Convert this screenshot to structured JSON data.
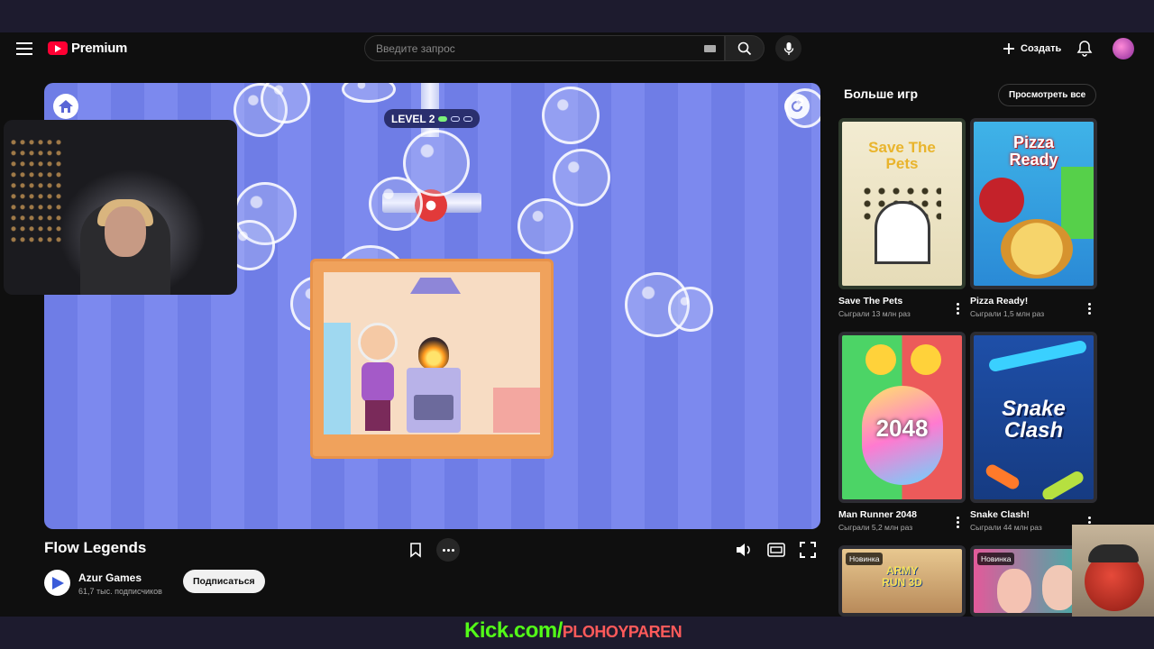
{
  "header": {
    "logo_text": "Premium",
    "search_placeholder": "Введите запрос",
    "create_label": "Создать"
  },
  "game": {
    "level_label": "LEVEL 2",
    "title": "Flow Legends",
    "channel_name": "Azur Games",
    "channel_subs": "61,7 тыс. подписчиков",
    "subscribe_label": "Подписаться"
  },
  "sidebar": {
    "heading": "Больше игр",
    "view_all": "Просмотреть все",
    "cards": [
      {
        "title": "Save The Pets",
        "plays": "Сыграли 13 млн раз",
        "thumb_text": "Save The Pets",
        "badge": ""
      },
      {
        "title": "Pizza Ready!",
        "plays": "Сыграли 1,5 млн раз",
        "thumb_text": "Pizza Ready",
        "badge": ""
      },
      {
        "title": "Man Runner 2048",
        "plays": "Сыграли 5,2 млн раз",
        "thumb_text": "2048",
        "badge": ""
      },
      {
        "title": "Snake Clash!",
        "plays": "Сыграли 44 млн раз",
        "thumb_text": "Snake Clash",
        "badge": ""
      },
      {
        "title": "",
        "plays": "",
        "thumb_text": "ARMY RUN 3D",
        "badge": "Новинка"
      },
      {
        "title": "",
        "plays": "",
        "thumb_text": "",
        "badge": "Новинка"
      }
    ]
  },
  "overlay": {
    "kick_domain": "Kick.com/",
    "kick_slug": "PLOHOYPAREN"
  },
  "colors": {
    "accent_red": "#ff0033",
    "game_blue": "#7c89ee",
    "kick_green": "#53fc18"
  }
}
